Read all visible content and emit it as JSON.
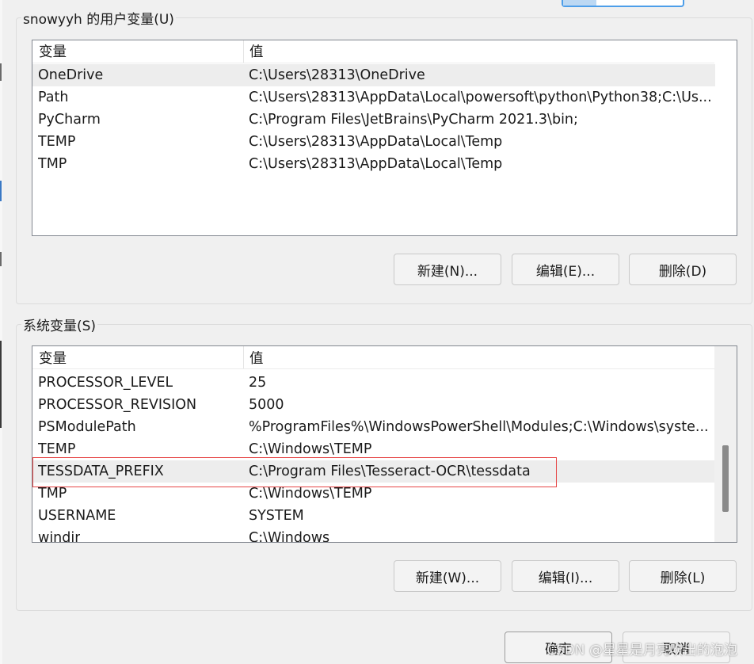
{
  "user_vars": {
    "group_title": "snowyyh 的用户变量(U)",
    "columns": {
      "name": "变量",
      "value": "值"
    },
    "rows": [
      {
        "name": "OneDrive",
        "value": "C:\\Users\\28313\\OneDrive",
        "selected": true
      },
      {
        "name": "Path",
        "value": "C:\\Users\\28313\\AppData\\Local\\powersoft\\python\\Python38;C:\\Us...",
        "selected": false
      },
      {
        "name": "PyCharm",
        "value": "C:\\Program Files\\JetBrains\\PyCharm 2021.3\\bin;",
        "selected": false
      },
      {
        "name": "TEMP",
        "value": "C:\\Users\\28313\\AppData\\Local\\Temp",
        "selected": false
      },
      {
        "name": "TMP",
        "value": "C:\\Users\\28313\\AppData\\Local\\Temp",
        "selected": false
      }
    ],
    "buttons": {
      "new": "新建(N)...",
      "edit": "编辑(E)...",
      "delete": "删除(D)"
    }
  },
  "system_vars": {
    "group_title": "系统变量(S)",
    "columns": {
      "name": "变量",
      "value": "值"
    },
    "rows": [
      {
        "name": "PROCESSOR_LEVEL",
        "value": "25",
        "selected": false
      },
      {
        "name": "PROCESSOR_REVISION",
        "value": "5000",
        "selected": false
      },
      {
        "name": "PSModulePath",
        "value": "%ProgramFiles%\\WindowsPowerShell\\Modules;C:\\Windows\\syste...",
        "selected": false
      },
      {
        "name": "TEMP",
        "value": "C:\\Windows\\TEMP",
        "selected": false
      },
      {
        "name": "TESSDATA_PREFIX",
        "value": "C:\\Program Files\\Tesseract-OCR\\tessdata",
        "selected": true,
        "highlighted": true
      },
      {
        "name": "TMP",
        "value": "C:\\Windows\\TEMP",
        "selected": false
      },
      {
        "name": "USERNAME",
        "value": "SYSTEM",
        "selected": false
      },
      {
        "name": "windir",
        "value": "C:\\Windows",
        "selected": false
      }
    ],
    "buttons": {
      "new": "新建(W)...",
      "edit": "编辑(I)...",
      "delete": "删除(L)"
    }
  },
  "dialog_buttons": {
    "ok": "确定",
    "cancel": "取消"
  },
  "watermark": "CSDN @星星是月亮吹出的泡泡",
  "colors": {
    "highlight_outline": "#e64545",
    "selected_row": "#ededed",
    "accent_blue": "#4d9ee9"
  }
}
